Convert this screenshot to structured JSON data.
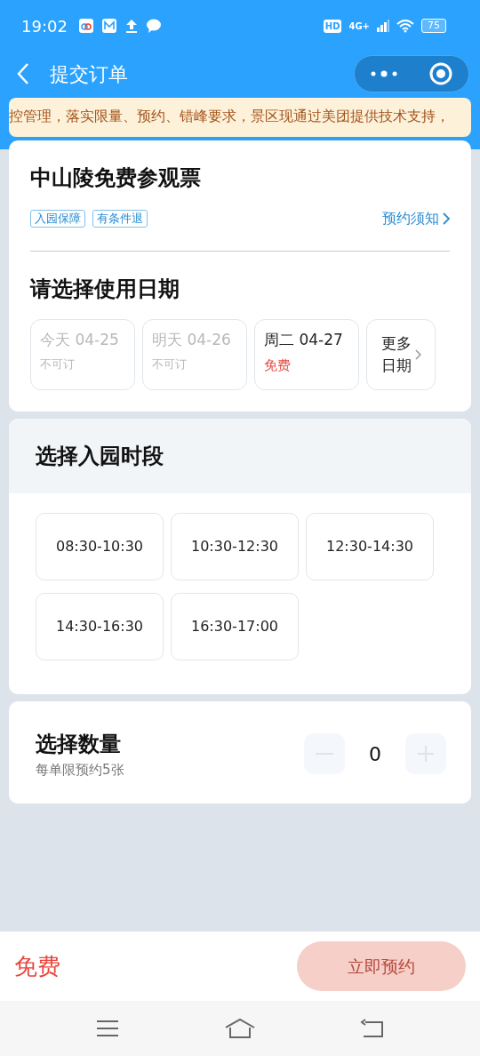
{
  "status_bar": {
    "time": "19:02",
    "hd": "HD",
    "network": "4G+",
    "battery": "75"
  },
  "nav": {
    "title": "提交订单"
  },
  "notice": "控管理，落实限量、预约、错峰要求，景区现通过美团提供技术支持，",
  "ticket": {
    "title": "中山陵免费参观票",
    "tags": [
      "入园保障",
      "有条件退"
    ],
    "notice_link": "预约须知"
  },
  "date_section": {
    "title": "请选择使用日期",
    "dates": [
      {
        "label": "今天 04-25",
        "sub": "不可订",
        "disabled": true,
        "selected": false
      },
      {
        "label": "明天 04-26",
        "sub": "不可订",
        "disabled": true,
        "selected": false
      },
      {
        "label": "周二 04-27",
        "sub": "免费",
        "disabled": false,
        "selected": false
      }
    ],
    "more": [
      "更多",
      "日期"
    ]
  },
  "time_section": {
    "title": "选择入园时段",
    "slots": [
      {
        "label": "08:30-10:30",
        "selected": false
      },
      {
        "label": "10:30-12:30",
        "selected": false
      },
      {
        "label": "12:30-14:30",
        "selected": false
      },
      {
        "label": "14:30-16:30",
        "selected": false
      },
      {
        "label": "16:30-17:00",
        "selected": false
      }
    ]
  },
  "quantity": {
    "title": "选择数量",
    "hint": "每单限预约5张",
    "value": "0",
    "disabled": true
  },
  "footer": {
    "price": "免费",
    "button": "立即预约",
    "disabled": true
  }
}
